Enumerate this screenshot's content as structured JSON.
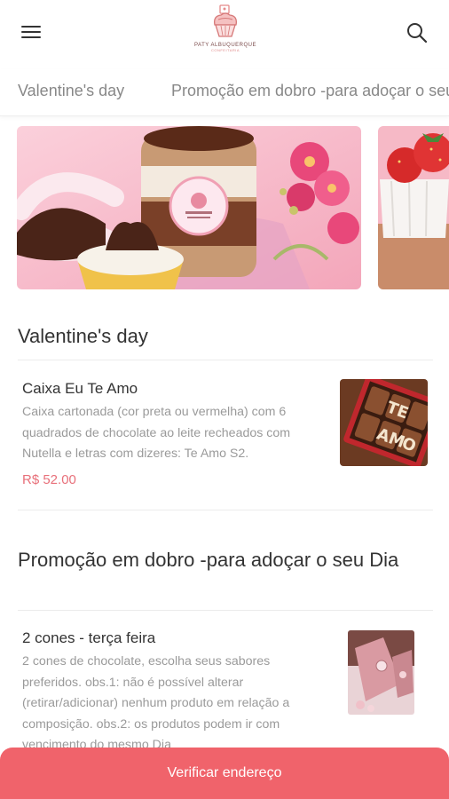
{
  "header": {
    "brand_name": "PATY ALBUQUERQUE",
    "brand_tagline": "CONFEITARIA"
  },
  "tabs": [
    {
      "label": "Valentine's day"
    },
    {
      "label": "Promoção em dobro -para adoçar o seu Dia"
    }
  ],
  "sections": [
    {
      "title": "Valentine's day",
      "products": [
        {
          "name": "Caixa Eu Te Amo",
          "description": "Caixa cartonada (cor preta ou vermelha) com 6 quadrados de chocolate ao leite recheados com Nutella e letras com dizeres: Te Amo S2.",
          "price": "R$ 52.00",
          "image_letters": [
            "TE",
            "AM",
            "O"
          ]
        }
      ]
    },
    {
      "title": "Promoção em dobro -para adoçar o seu Dia",
      "products": [
        {
          "name": "2 cones - terça feira",
          "description": "2 cones de chocolate, escolha seus sabores preferidos. obs.1: não é possível alterar (retirar/adicionar) nenhum produto em relação a composição. obs.2: os produtos podem ir com vencimento do mesmo Dia"
        }
      ]
    }
  ],
  "bottom_button": {
    "label": "Verificar endereço"
  },
  "colors": {
    "accent": "#f0636b",
    "price": "#e8707a",
    "banner_bg": "#f7b9c8"
  }
}
